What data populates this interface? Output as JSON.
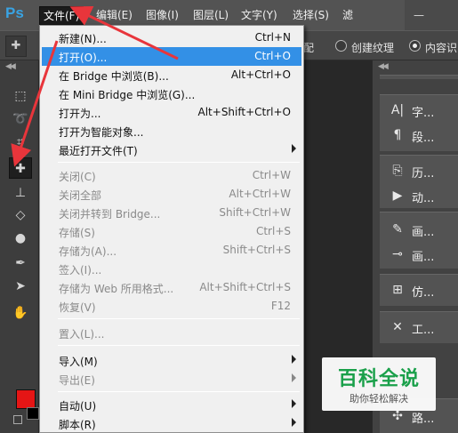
{
  "app": {
    "logo": "Ps"
  },
  "menubar": {
    "items": [
      "文件(F)",
      "编辑(E)",
      "图像(I)",
      "图层(L)",
      "文字(Y)",
      "选择(S)",
      "滤"
    ],
    "minimize": "—"
  },
  "options_bar": {
    "fragment": "配",
    "radio_create_texture": "创建纹理",
    "radio_content": "内容识"
  },
  "file_menu": {
    "items": [
      {
        "label": "新建(N)...",
        "shortcut": "Ctrl+N"
      },
      {
        "label": "打开(O)...",
        "shortcut": "Ctrl+O"
      },
      {
        "label": "在 Bridge 中浏览(B)...",
        "shortcut": "Alt+Ctrl+O"
      },
      {
        "label": "在 Mini Bridge 中浏览(G)...",
        "shortcut": ""
      },
      {
        "label": "打开为...",
        "shortcut": "Alt+Shift+Ctrl+O"
      },
      {
        "label": "打开为智能对象...",
        "shortcut": ""
      },
      {
        "label": "最近打开文件(T)",
        "shortcut": ""
      },
      {
        "label": "关闭(C)",
        "shortcut": "Ctrl+W"
      },
      {
        "label": "关闭全部",
        "shortcut": "Alt+Ctrl+W"
      },
      {
        "label": "关闭并转到 Bridge...",
        "shortcut": "Shift+Ctrl+W"
      },
      {
        "label": "存储(S)",
        "shortcut": "Ctrl+S"
      },
      {
        "label": "存储为(A)...",
        "shortcut": "Shift+Ctrl+S"
      },
      {
        "label": "签入(I)...",
        "shortcut": ""
      },
      {
        "label": "存储为 Web 所用格式...",
        "shortcut": "Alt+Shift+Ctrl+S"
      },
      {
        "label": "恢复(V)",
        "shortcut": "F12"
      },
      {
        "label": "置入(L)...",
        "shortcut": ""
      },
      {
        "label": "导入(M)",
        "shortcut": ""
      },
      {
        "label": "导出(E)",
        "shortcut": ""
      },
      {
        "label": "自动(U)",
        "shortcut": ""
      },
      {
        "label": "脚本(R)",
        "shortcut": ""
      }
    ]
  },
  "right_panels": {
    "items": [
      {
        "icon": "A|",
        "label": "字..."
      },
      {
        "icon": "¶",
        "label": "段..."
      },
      {
        "icon": "⎘",
        "label": "历..."
      },
      {
        "icon": "▶",
        "label": "动..."
      },
      {
        "icon": "✎",
        "label": "画..."
      },
      {
        "icon": "⊸",
        "label": "画..."
      },
      {
        "icon": "⊞",
        "label": "仿..."
      },
      {
        "icon": "✕",
        "label": "工..."
      },
      {
        "icon": "✣",
        "label": "路..."
      }
    ]
  },
  "watermark": {
    "title": "百科全说",
    "subtitle": "助你轻松解决"
  },
  "colors": {
    "foreground": "#e51515",
    "background": "#000000",
    "menu_highlight": "#3390e6",
    "arrow": "#e8353b",
    "watermark_green": "#1aa04a"
  }
}
